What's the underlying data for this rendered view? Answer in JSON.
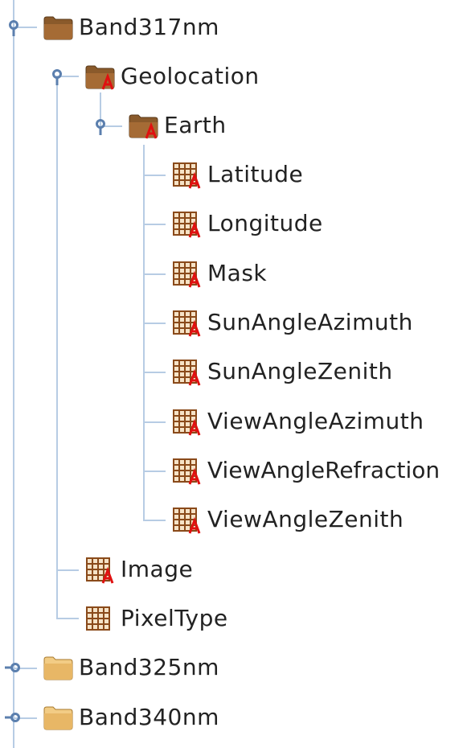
{
  "tree": {
    "nodes": [
      {
        "id": "band317",
        "label": "Band317nm",
        "type": "group",
        "state": "expanded",
        "attr": false,
        "toggle": true
      },
      {
        "id": "geolocation",
        "label": "Geolocation",
        "type": "group",
        "state": "expanded",
        "attr": true,
        "toggle": true
      },
      {
        "id": "earth",
        "label": "Earth",
        "type": "group",
        "state": "expanded",
        "attr": true,
        "toggle": true
      },
      {
        "id": "latitude",
        "label": "Latitude",
        "type": "dataset",
        "attr": true
      },
      {
        "id": "longitude",
        "label": "Longitude",
        "type": "dataset",
        "attr": true
      },
      {
        "id": "mask",
        "label": "Mask",
        "type": "dataset",
        "attr": true
      },
      {
        "id": "sunangleazimuth",
        "label": "SunAngleAzimuth",
        "type": "dataset",
        "attr": true
      },
      {
        "id": "sunanglezenith",
        "label": "SunAngleZenith",
        "type": "dataset",
        "attr": true
      },
      {
        "id": "viewangleazimuth",
        "label": "ViewAngleAzimuth",
        "type": "dataset",
        "attr": true
      },
      {
        "id": "viewanglerefraction",
        "label": "ViewAngleRefraction",
        "type": "dataset",
        "attr": true
      },
      {
        "id": "viewanglezenith",
        "label": "ViewAngleZenith",
        "type": "dataset",
        "attr": true
      },
      {
        "id": "image",
        "label": "Image",
        "type": "dataset",
        "attr": true
      },
      {
        "id": "pixeltype",
        "label": "PixelType",
        "type": "dataset",
        "attr": false
      },
      {
        "id": "band325",
        "label": "Band325nm",
        "type": "group",
        "state": "collapsed",
        "attr": false,
        "toggle": true
      },
      {
        "id": "band340",
        "label": "Band340nm",
        "type": "group",
        "state": "collapsed",
        "attr": false,
        "toggle": true
      }
    ]
  },
  "colors": {
    "tree_line": "#b7cce4",
    "toggle_handle": "#5b7fae",
    "folder_expanded": "#8a5a2b",
    "folder_collapsed": "#e8b766",
    "dataset_grid": "#8a4a1a",
    "attribute_marker": "#e01010",
    "label_text": "#222222"
  }
}
